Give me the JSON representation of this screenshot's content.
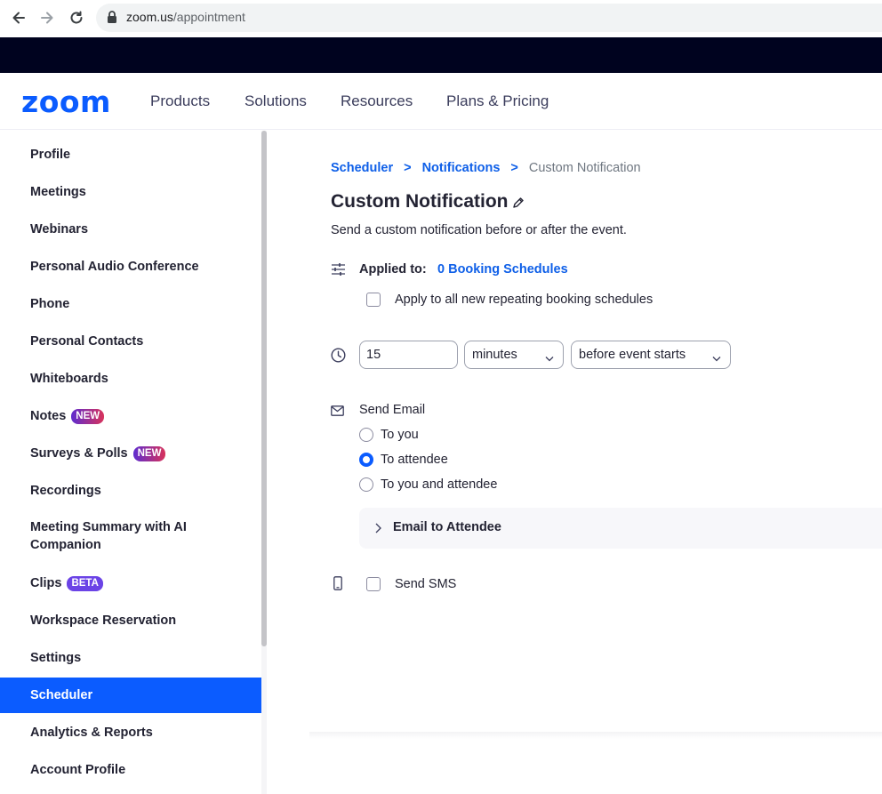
{
  "browser": {
    "url_host": "zoom.us",
    "url_path": "/appointment"
  },
  "header": {
    "logo": "zoom",
    "nav": [
      "Products",
      "Solutions",
      "Resources",
      "Plans & Pricing"
    ]
  },
  "sidebar": {
    "items": [
      {
        "label": "Profile"
      },
      {
        "label": "Meetings"
      },
      {
        "label": "Webinars"
      },
      {
        "label": "Personal Audio Conference"
      },
      {
        "label": "Phone"
      },
      {
        "label": "Personal Contacts"
      },
      {
        "label": "Whiteboards"
      },
      {
        "label": "Notes",
        "badge": "NEW"
      },
      {
        "label": "Surveys & Polls",
        "badge": "NEW"
      },
      {
        "label": "Recordings"
      },
      {
        "label": "Meeting Summary with AI Companion"
      },
      {
        "label": "Clips",
        "badge": "BETA"
      },
      {
        "label": "Workspace Reservation"
      },
      {
        "label": "Settings"
      },
      {
        "label": "Scheduler",
        "active": true
      },
      {
        "label": "Analytics & Reports"
      },
      {
        "label": "Account Profile"
      }
    ]
  },
  "breadcrumb": {
    "items": [
      "Scheduler",
      "Notifications",
      "Custom Notification"
    ],
    "separator": ">"
  },
  "main": {
    "title": "Custom Notification",
    "subtitle": "Send a custom notification before or after the event.",
    "applied_to_label": "Applied to:",
    "applied_to_link": "0 Booking Schedules",
    "apply_all_label": "Apply to all new repeating booking schedules",
    "apply_all_checked": false,
    "time_value": "15",
    "unit_selected": "minutes",
    "timing_selected": "before event starts",
    "send_email_label": "Send Email",
    "email_options": [
      {
        "label": "To you",
        "checked": false
      },
      {
        "label": "To attendee",
        "checked": true
      },
      {
        "label": "To you and attendee",
        "checked": false
      }
    ],
    "email_section_label": "Email to Attendee",
    "send_sms_label": "Send SMS",
    "send_sms_checked": false
  },
  "colors": {
    "brand": "#0b5cff",
    "link": "#0e5fe8",
    "top_band": "#00031f",
    "text": "#232333"
  }
}
